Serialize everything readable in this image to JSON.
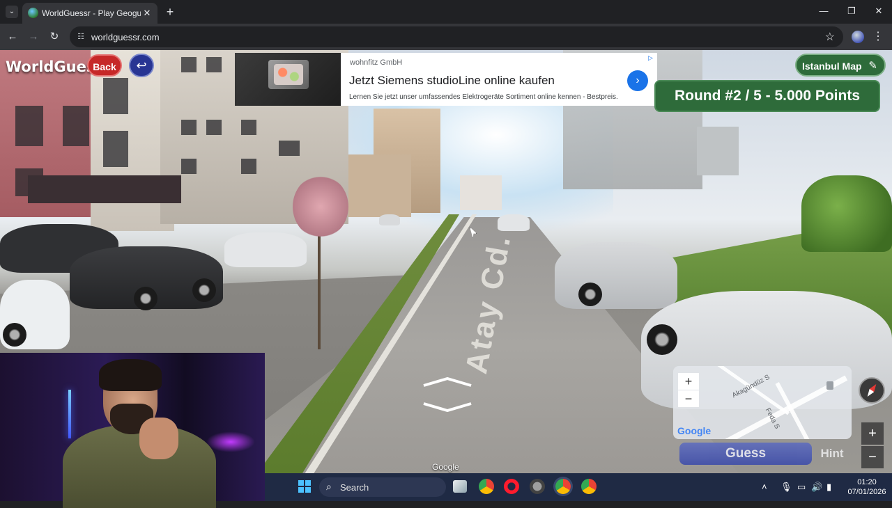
{
  "browser": {
    "tab_title": "WorldGuessr - Play Geoguessr Free",
    "url": "worldguessr.com",
    "tab_close": "✕",
    "new_tab": "+",
    "minimize": "—",
    "maximize": "❐",
    "close": "✕"
  },
  "game": {
    "logo": "WorldGuessr",
    "back_label": "Back",
    "map_label": "Istanbul Map",
    "round_banner": "Round #2 / 5 - 5.000 Points",
    "guess_label": "Guess",
    "hint_label": "Hint"
  },
  "ad": {
    "sponsor": "wohnfitz GmbH",
    "headline": "Jetzt Siemens studioLine online kaufen",
    "description": "Lernen Sie jetzt unser umfassendes Elektrogeräte Sortiment online kennen - Bestpreis."
  },
  "streetview": {
    "street_name": "Atay Cd.",
    "google_mark": "Google",
    "zoom_in": "+",
    "zoom_out": "−"
  },
  "minimap": {
    "zoom_in": "+",
    "zoom_out": "−",
    "street_1": "Akagündüz S",
    "street_2": "Feda S",
    "google": "Google"
  },
  "taskbar": {
    "search_label": "Search",
    "time": "01:20",
    "date": "07/01/2026"
  },
  "colors": {
    "accent_green": "#2e6b3a",
    "back_red": "#c62828",
    "guess_blue": "#3949ab"
  }
}
